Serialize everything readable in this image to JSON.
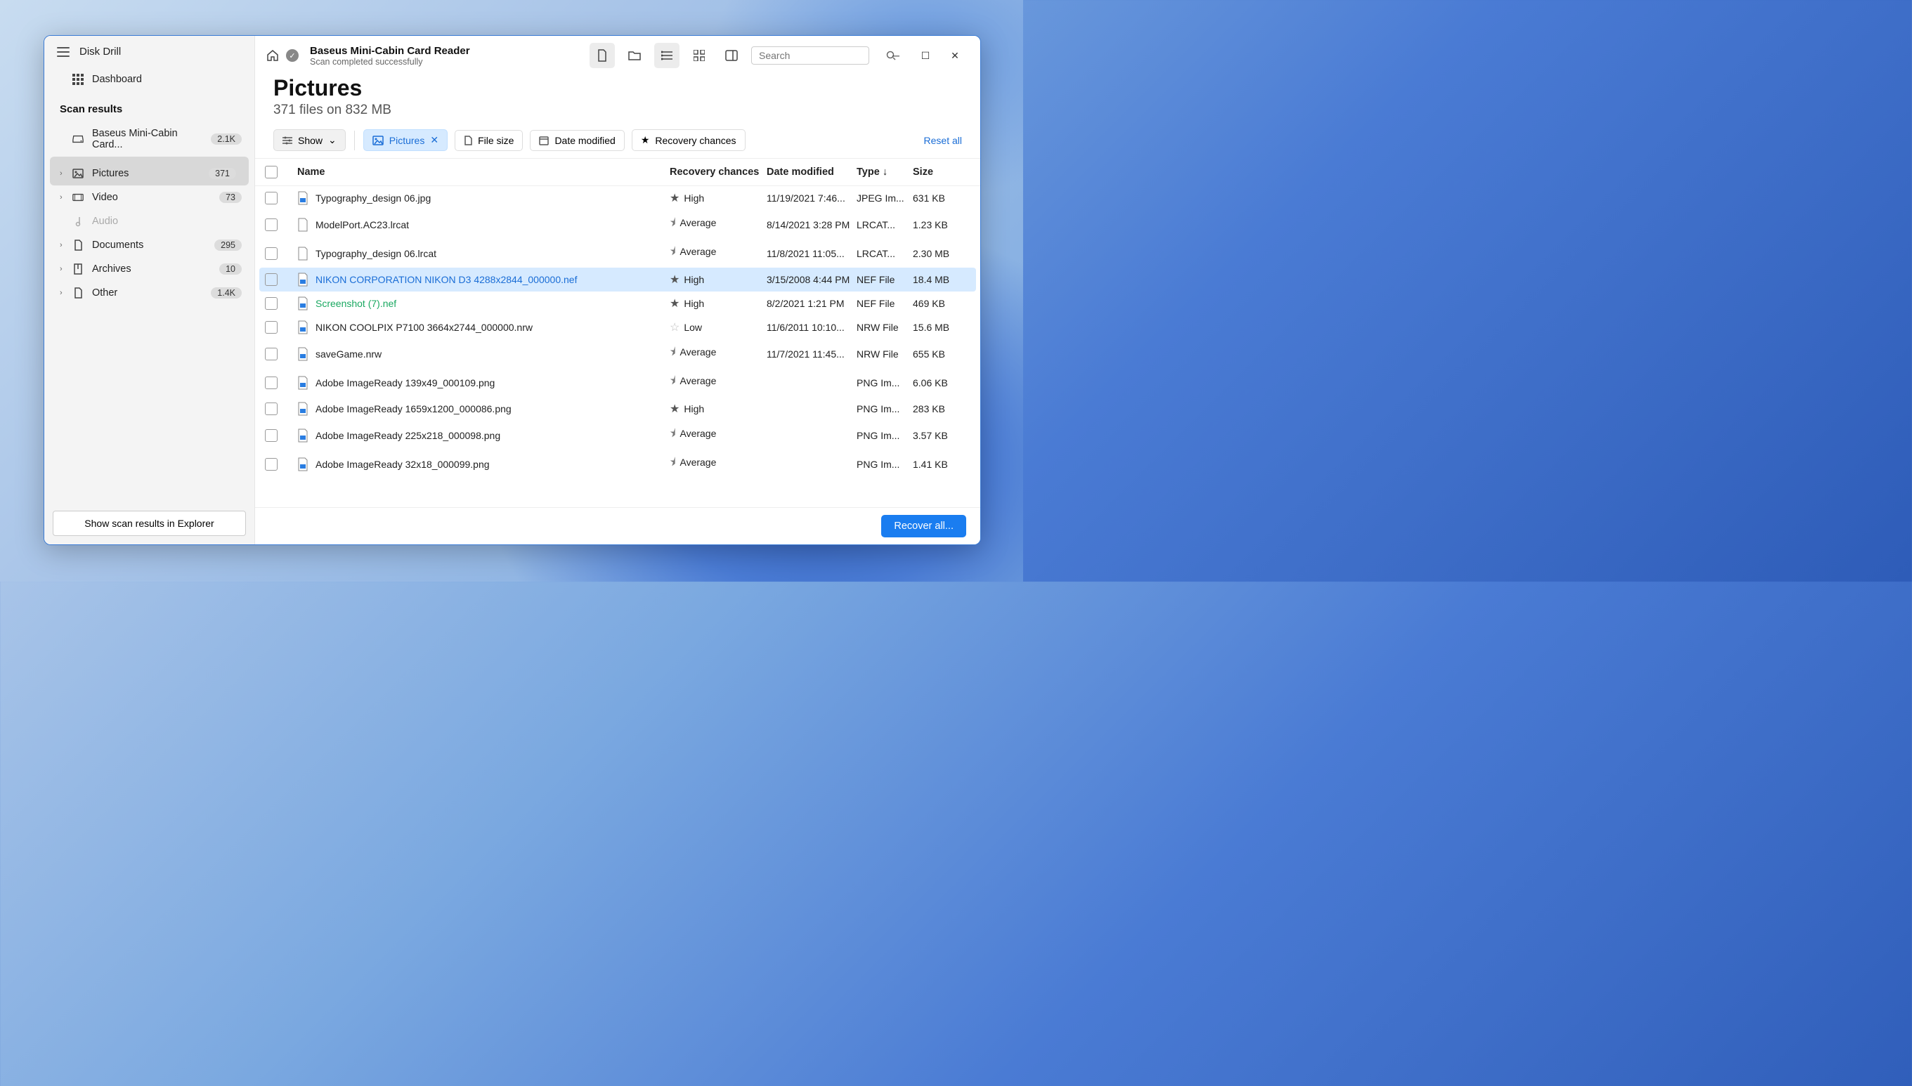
{
  "app": {
    "title": "Disk Drill"
  },
  "sidebar": {
    "dashboard": "Dashboard",
    "section": "Scan results",
    "device": {
      "label": "Baseus Mini-Cabin Card...",
      "count": "2.1K"
    },
    "items": [
      {
        "label": "Pictures",
        "count": "371",
        "active": true
      },
      {
        "label": "Video",
        "count": "73"
      },
      {
        "label": "Audio",
        "disabled": true
      },
      {
        "label": "Documents",
        "count": "295"
      },
      {
        "label": "Archives",
        "count": "10"
      },
      {
        "label": "Other",
        "count": "1.4K"
      }
    ],
    "footer_button": "Show scan results in Explorer"
  },
  "header": {
    "title": "Baseus Mini-Cabin Card Reader",
    "subtitle": "Scan completed successfully",
    "search_placeholder": "Search"
  },
  "page": {
    "title": "Pictures",
    "subtitle": "371 files on 832 MB"
  },
  "filters": {
    "show": "Show",
    "pictures": "Pictures",
    "file_size": "File size",
    "date_modified": "Date modified",
    "recovery": "Recovery chances",
    "reset": "Reset all"
  },
  "columns": {
    "name": "Name",
    "recovery": "Recovery chances",
    "date": "Date modified",
    "type": "Type",
    "size": "Size"
  },
  "rows": [
    {
      "name": "Typography_design 06.jpg",
      "rec": "High",
      "star": "full",
      "date": "11/19/2021 7:46...",
      "type": "JPEG Im...",
      "size": "631 KB",
      "imgicon": true
    },
    {
      "name": "ModelPort.AC23.lrcat",
      "rec": "Average",
      "star": "half",
      "date": "8/14/2021 3:28 PM",
      "type": "LRCAT...",
      "size": "1.23 KB"
    },
    {
      "name": "Typography_design 06.lrcat",
      "rec": "Average",
      "star": "half",
      "date": "11/8/2021 11:05...",
      "type": "LRCAT...",
      "size": "2.30 MB"
    },
    {
      "name": "NIKON CORPORATION NIKON D3 4288x2844_000000.nef",
      "rec": "High",
      "star": "full",
      "date": "3/15/2008 4:44 PM",
      "type": "NEF File",
      "size": "18.4 MB",
      "sel": true,
      "imgicon": true
    },
    {
      "name": "Screenshot (7).nef",
      "rec": "High",
      "star": "full",
      "date": "8/2/2021 1:21 PM",
      "type": "NEF File",
      "size": "469 KB",
      "green": true,
      "imgicon": true
    },
    {
      "name": "NIKON COOLPIX P7100 3664x2744_000000.nrw",
      "rec": "Low",
      "star": "empty",
      "date": "11/6/2011 10:10...",
      "type": "NRW File",
      "size": "15.6 MB",
      "imgicon": true
    },
    {
      "name": "saveGame.nrw",
      "rec": "Average",
      "star": "half",
      "date": "11/7/2021 11:45...",
      "type": "NRW File",
      "size": "655 KB",
      "imgicon": true
    },
    {
      "name": "Adobe ImageReady 139x49_000109.png",
      "rec": "Average",
      "star": "half",
      "date": "",
      "type": "PNG Im...",
      "size": "6.06 KB",
      "imgicon": true
    },
    {
      "name": "Adobe ImageReady 1659x1200_000086.png",
      "rec": "High",
      "star": "full",
      "date": "",
      "type": "PNG Im...",
      "size": "283 KB",
      "imgicon": true
    },
    {
      "name": "Adobe ImageReady 225x218_000098.png",
      "rec": "Average",
      "star": "half",
      "date": "",
      "type": "PNG Im...",
      "size": "3.57 KB",
      "imgicon": true
    },
    {
      "name": "Adobe ImageReady 32x18_000099.png",
      "rec": "Average",
      "star": "half",
      "date": "",
      "type": "PNG Im...",
      "size": "1.41 KB",
      "imgicon": true
    }
  ],
  "footer": {
    "recover": "Recover all..."
  }
}
